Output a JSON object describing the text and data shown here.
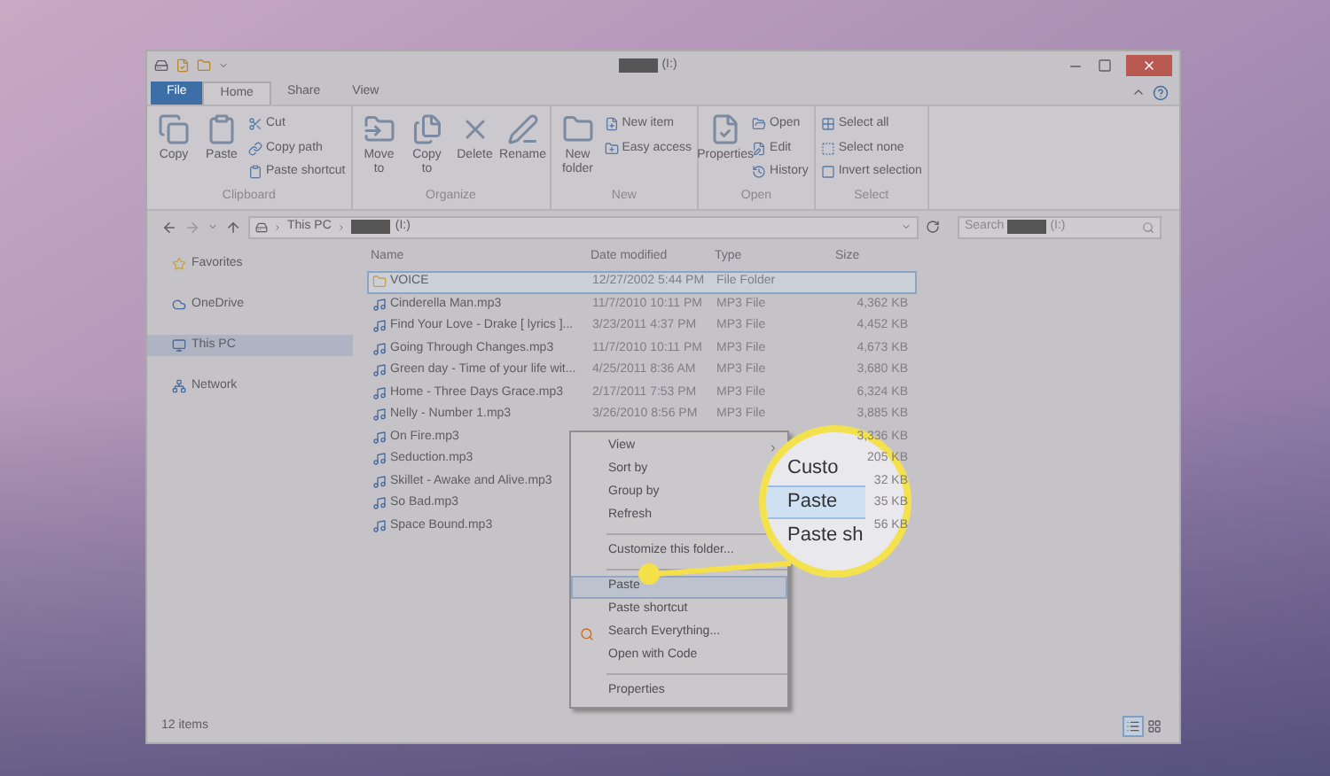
{
  "window": {
    "title": "(I:)"
  },
  "ribbon_tabs": [
    {
      "label": "File",
      "selected": false,
      "kind": "file"
    },
    {
      "label": "Home",
      "selected": true,
      "kind": "tab"
    },
    {
      "label": "Share",
      "selected": false,
      "kind": "tab"
    },
    {
      "label": "View",
      "selected": false,
      "kind": "tab"
    }
  ],
  "ribbon_groups": [
    {
      "label": "Clipboard",
      "large": [
        "Copy",
        "Paste"
      ],
      "small": [
        "Cut",
        "Copy path",
        "Paste shortcut"
      ]
    },
    {
      "label": "Organize",
      "large": [
        "Move to",
        "Copy to",
        "Delete",
        "Rename"
      ]
    },
    {
      "label": "New",
      "large": [
        "New folder"
      ],
      "small": [
        "New item",
        "Easy access"
      ]
    },
    {
      "label": "Open",
      "large": [
        "Properties"
      ],
      "small": [
        "Open",
        "Edit",
        "History"
      ]
    },
    {
      "label": "Select",
      "small": [
        "Select all",
        "Select none",
        "Invert selection"
      ]
    }
  ],
  "address": {
    "crumbs": [
      "This PC",
      "(I:)"
    ]
  },
  "search": {
    "prefix": "Search",
    "suffix": "(I:)"
  },
  "nav_items": [
    {
      "label": "Favorites",
      "selected": false
    },
    {
      "label": "OneDrive",
      "selected": false
    },
    {
      "label": "This PC",
      "selected": true
    },
    {
      "label": "Network",
      "selected": false
    }
  ],
  "columns": [
    "Name",
    "Date modified",
    "Type",
    "Size"
  ],
  "files": [
    {
      "name": "VOICE",
      "kind": "folder",
      "date": "12/27/2002 5:44 PM",
      "type": "File Folder",
      "selected": true
    },
    {
      "name": "Cinderella Man.mp3",
      "kind": "audio",
      "date": "11/7/2010 10:11 PM",
      "type": "MP3 File",
      "size": "4,362 KB",
      "selected": false
    },
    {
      "name": "Find Your Love - Drake [ lyrics ]...",
      "kind": "audio",
      "date": "3/23/2011 4:37 PM",
      "type": "MP3 File",
      "size": "4,452 KB",
      "selected": false
    },
    {
      "name": "Going Through Changes.mp3",
      "kind": "audio",
      "date": "11/7/2010 10:11 PM",
      "type": "MP3 File",
      "size": "4,673 KB",
      "selected": false
    },
    {
      "name": "Green day - Time of your life wit...",
      "kind": "audio",
      "date": "4/25/2011 8:36 AM",
      "type": "MP3 File",
      "size": "3,680 KB",
      "selected": false
    },
    {
      "name": "Home - Three Days Grace.mp3",
      "kind": "audio",
      "date": "2/17/2011 7:53 PM",
      "type": "MP3 File",
      "size": "6,324 KB",
      "selected": false
    },
    {
      "name": "Nelly - Number 1.mp3",
      "kind": "audio",
      "date": "3/26/2010 8:56 PM",
      "type": "MP3 File",
      "size": "3,885 KB",
      "selected": false
    },
    {
      "name": "On Fire.mp3",
      "kind": "audio",
      "size": "3,336 KB",
      "selected": false
    },
    {
      "name": "Seduction.mp3",
      "kind": "audio",
      "size": "205 KB",
      "selected": false
    },
    {
      "name": "Skillet - Awake and Alive.mp3",
      "kind": "audio",
      "size": "32 KB",
      "selected": false
    },
    {
      "name": "So Bad.mp3",
      "kind": "audio",
      "size": "35 KB",
      "selected": false
    },
    {
      "name": "Space Bound.mp3",
      "kind": "audio",
      "size": "56 KB",
      "selected": false
    }
  ],
  "context_menu": [
    {
      "kind": "submenu",
      "label": "View",
      "selected": false
    },
    {
      "kind": "item",
      "label": "Sort by",
      "selected": false
    },
    {
      "kind": "item",
      "label": "Group by",
      "selected": false
    },
    {
      "kind": "item",
      "label": "Refresh",
      "selected": false
    },
    {
      "kind": "separator"
    },
    {
      "kind": "item",
      "label": "Customize this folder...",
      "selected": false
    },
    {
      "kind": "separator"
    },
    {
      "kind": "item",
      "label": "Paste",
      "selected": true
    },
    {
      "kind": "item",
      "label": "Paste shortcut",
      "selected": false
    },
    {
      "kind": "icon",
      "label": "Search Everything...",
      "selected": false
    },
    {
      "kind": "item",
      "label": "Open with Code",
      "selected": false
    },
    {
      "kind": "separator"
    },
    {
      "kind": "item",
      "label": "Properties",
      "selected": false
    }
  ],
  "magnifier": [
    {
      "label": "Custo",
      "selected": false
    },
    {
      "label": "Paste",
      "selected": true
    },
    {
      "label": "Paste sh",
      "selected": false
    }
  ],
  "status_bar": {
    "count": "12 items",
    "views": [
      {
        "kind": "details",
        "selected": true
      },
      {
        "kind": "tiles",
        "selected": false
      }
    ]
  }
}
